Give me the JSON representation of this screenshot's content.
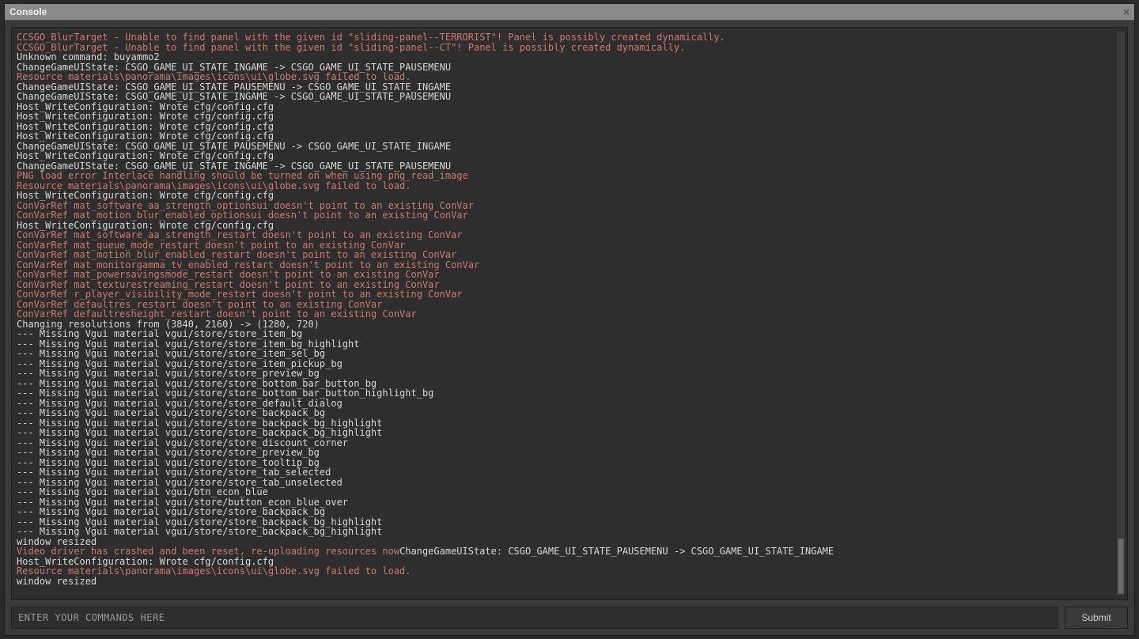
{
  "window": {
    "title": "Console",
    "close_glyph": "×"
  },
  "input": {
    "placeholder": "ENTER YOUR COMMANDS HERE",
    "submit_label": "Submit"
  },
  "log": [
    {
      "c": "err",
      "t": "CCSGO_BlurTarget - Unable to find panel with the given id \"sliding-panel--TERRORIST\"! Panel is possibly created dynamically."
    },
    {
      "c": "err",
      "t": "CCSGO_BlurTarget - Unable to find panel with the given id \"sliding-panel--CT\"! Panel is possibly created dynamically."
    },
    {
      "c": "norm",
      "t": "Unknown command: buyammo2"
    },
    {
      "c": "norm",
      "t": "ChangeGameUIState: CSGO_GAME_UI_STATE_INGAME -> CSGO_GAME_UI_STATE_PAUSEMENU"
    },
    {
      "c": "err",
      "t": "Resource materials\\panorama\\images\\icons\\ui\\globe.svg failed to load."
    },
    {
      "c": "norm",
      "t": "ChangeGameUIState: CSGO_GAME_UI_STATE_PAUSEMENU -> CSGO_GAME_UI_STATE_INGAME"
    },
    {
      "c": "norm",
      "t": "ChangeGameUIState: CSGO_GAME_UI_STATE_INGAME -> CSGO_GAME_UI_STATE_PAUSEMENU"
    },
    {
      "c": "norm",
      "t": "Host_WriteConfiguration: Wrote cfg/config.cfg"
    },
    {
      "c": "norm",
      "t": "Host_WriteConfiguration: Wrote cfg/config.cfg"
    },
    {
      "c": "norm",
      "t": "Host_WriteConfiguration: Wrote cfg/config.cfg"
    },
    {
      "c": "norm",
      "t": "Host_WriteConfiguration: Wrote cfg/config.cfg"
    },
    {
      "c": "norm",
      "t": "ChangeGameUIState: CSGO_GAME_UI_STATE_PAUSEMENU -> CSGO_GAME_UI_STATE_INGAME"
    },
    {
      "c": "norm",
      "t": "Host_WriteConfiguration: Wrote cfg/config.cfg"
    },
    {
      "c": "norm",
      "t": "ChangeGameUIState: CSGO_GAME_UI_STATE_INGAME -> CSGO_GAME_UI_STATE_PAUSEMENU"
    },
    {
      "c": "err",
      "t": "PNG load error Interlace handling should be turned on when using png_read_image"
    },
    {
      "c": "err",
      "t": "Resource materials\\panorama\\images\\icons\\ui\\globe.svg failed to load."
    },
    {
      "c": "norm",
      "t": "Host_WriteConfiguration: Wrote cfg/config.cfg"
    },
    {
      "c": "err",
      "t": "ConVarRef mat_software_aa_strength_optionsui doesn't point to an existing ConVar"
    },
    {
      "c": "err",
      "t": "ConVarRef mat_motion_blur_enabled_optionsui doesn't point to an existing ConVar"
    },
    {
      "c": "norm",
      "t": "Host_WriteConfiguration: Wrote cfg/config.cfg"
    },
    {
      "c": "err",
      "t": "ConVarRef mat_software_aa_strength_restart doesn't point to an existing ConVar"
    },
    {
      "c": "err",
      "t": "ConVarRef mat_queue_mode_restart doesn't point to an existing ConVar"
    },
    {
      "c": "err",
      "t": "ConVarRef mat_motion_blur_enabled_restart doesn't point to an existing ConVar"
    },
    {
      "c": "err",
      "t": "ConVarRef mat_monitorgamma_tv_enabled_restart doesn't point to an existing ConVar"
    },
    {
      "c": "err",
      "t": "ConVarRef mat_powersavingsmode_restart doesn't point to an existing ConVar"
    },
    {
      "c": "err",
      "t": "ConVarRef mat_texturestreaming_restart doesn't point to an existing ConVar"
    },
    {
      "c": "err",
      "t": "ConVarRef r_player_visibility_mode_restart doesn't point to an existing ConVar"
    },
    {
      "c": "err",
      "t": "ConVarRef defaultres_restart doesn't point to an existing ConVar"
    },
    {
      "c": "err",
      "t": "ConVarRef defaultresheight_restart doesn't point to an existing ConVar"
    },
    {
      "c": "norm",
      "t": "Changing resolutions from (3840, 2160) -> (1280, 720)"
    },
    {
      "c": "norm",
      "t": "--- Missing Vgui material vgui/store/store_item_bg"
    },
    {
      "c": "norm",
      "t": "--- Missing Vgui material vgui/store/store_item_bg_highlight"
    },
    {
      "c": "norm",
      "t": "--- Missing Vgui material vgui/store/store_item_sel_bg"
    },
    {
      "c": "norm",
      "t": "--- Missing Vgui material vgui/store/store_item_pickup_bg"
    },
    {
      "c": "norm",
      "t": "--- Missing Vgui material vgui/store/store_preview_bg"
    },
    {
      "c": "norm",
      "t": "--- Missing Vgui material vgui/store/store_bottom_bar_button_bg"
    },
    {
      "c": "norm",
      "t": "--- Missing Vgui material vgui/store/store_bottom_bar_button_highlight_bg"
    },
    {
      "c": "norm",
      "t": "--- Missing Vgui material vgui/store/store_default_dialog"
    },
    {
      "c": "norm",
      "t": "--- Missing Vgui material vgui/store/store_backpack_bg"
    },
    {
      "c": "norm",
      "t": "--- Missing Vgui material vgui/store/store_backpack_bg_highlight"
    },
    {
      "c": "norm",
      "t": "--- Missing Vgui material vgui/store/store_backpack_bg_highlight"
    },
    {
      "c": "norm",
      "t": "--- Missing Vgui material vgui/store/store_discount_corner"
    },
    {
      "c": "norm",
      "t": "--- Missing Vgui material vgui/store/store_preview_bg"
    },
    {
      "c": "norm",
      "t": "--- Missing Vgui material vgui/store/store_tooltip_bg"
    },
    {
      "c": "norm",
      "t": "--- Missing Vgui material vgui/store/store_tab_selected"
    },
    {
      "c": "norm",
      "t": "--- Missing Vgui material vgui/store/store_tab_unselected"
    },
    {
      "c": "norm",
      "t": "--- Missing Vgui material vgui/btn_econ_blue"
    },
    {
      "c": "norm",
      "t": "--- Missing Vgui material vgui/store/button_econ_blue_over"
    },
    {
      "c": "norm",
      "t": "--- Missing Vgui material vgui/store/store_backpack_bg"
    },
    {
      "c": "norm",
      "t": "--- Missing Vgui material vgui/store/store_backpack_bg_highlight"
    },
    {
      "c": "norm",
      "t": "--- Missing Vgui material vgui/store/store_backpack_bg_highlight"
    },
    {
      "c": "norm",
      "t": "window resized"
    },
    {
      "c": "mix",
      "parts": [
        {
          "c": "err",
          "t": "Video driver has crashed and been reset, re-uploading resources now"
        },
        {
          "c": "norm",
          "t": "ChangeGameUIState: CSGO_GAME_UI_STATE_PAUSEMENU -> CSGO_GAME_UI_STATE_INGAME"
        }
      ]
    },
    {
      "c": "norm",
      "t": "Host_WriteConfiguration: Wrote cfg/config.cfg"
    },
    {
      "c": "err",
      "t": "Resource materials\\panorama\\images\\icons\\ui\\globe.svg failed to load."
    },
    {
      "c": "norm",
      "t": "window resized"
    }
  ]
}
